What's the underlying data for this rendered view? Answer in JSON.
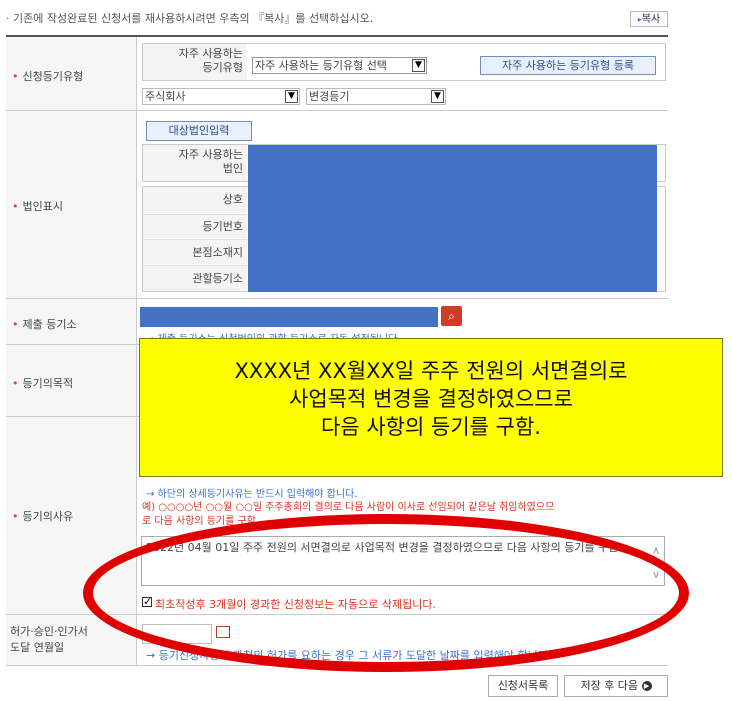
{
  "notice": "· 기존에 작성완료된 신청서를 재사용하시려면 우측의 『복사』를 선택하십시오.",
  "copy_button": "복사",
  "rows": {
    "registration_type": {
      "label": "신청등기유형",
      "favorite_label_1": "자주 사용하는",
      "favorite_label_2": "등기유형",
      "favorite_select": "자주 사용하는 등기유형 선택",
      "favorite_register_button": "자주 사용하는 등기유형 등록",
      "company_type": "주식회사",
      "change_type": "변경등기"
    },
    "corporation": {
      "label": "법인표시",
      "target_button": "대상법인입력",
      "favorite_label_1": "자주 사용하는",
      "favorite_label_2": "법인",
      "name_label": "상호",
      "regno_label": "등기번호",
      "hq_label": "본점소재지",
      "office_label": "관할등기소"
    },
    "office": {
      "label": "제출 등기소",
      "note": "→ 제출 등기소는 신청법인의 관할 등기소로 자동 설정됩니다"
    },
    "purpose": {
      "label": "등기의목적"
    },
    "reason": {
      "label": "등기의사유",
      "note": "→ 하단의 상세등기사유는 반드시 입력해야 합니다.",
      "example_line1": "예) ○○○○년 ○○월 ○○일 주주총회의 결의로 다음 사람이 이사로 선임되어 같은날 취임하였으므",
      "example_line2": "로 다음 사항의 등기를 구함",
      "textarea_value": "2022년 04월 01일 주주 전원의 서면결의로 사업목적 변경을 결정하였으므로 다음 사항의 등기를 구함.",
      "checkbox_label": "최초작성후 3개월이 경과한 신청정보는 자동으로 삭제됩니다."
    },
    "permit": {
      "label_1": "허가·승인·인가서",
      "label_2": "도달 연월일",
      "note": "→ 등기신청사항이 관청의 허가를 요하는 경우 그 서류가 도달한 날짜를 입력해야 합니다."
    }
  },
  "overlay": {
    "line1": "XXXX년 XX월XX일 주주 전원의 서면결의로",
    "line2": "사업목적 변경을 결정하였으므로",
    "line3": "다음 사항의 등기를 구함."
  },
  "buttons": {
    "list": "신청서목록",
    "save_next": "저장 후 다음"
  },
  "colors": {
    "mask": "#4472c4",
    "overlay": "#ffff00",
    "annotation_ellipse": "#e00000",
    "required_star": "#e0452c"
  }
}
